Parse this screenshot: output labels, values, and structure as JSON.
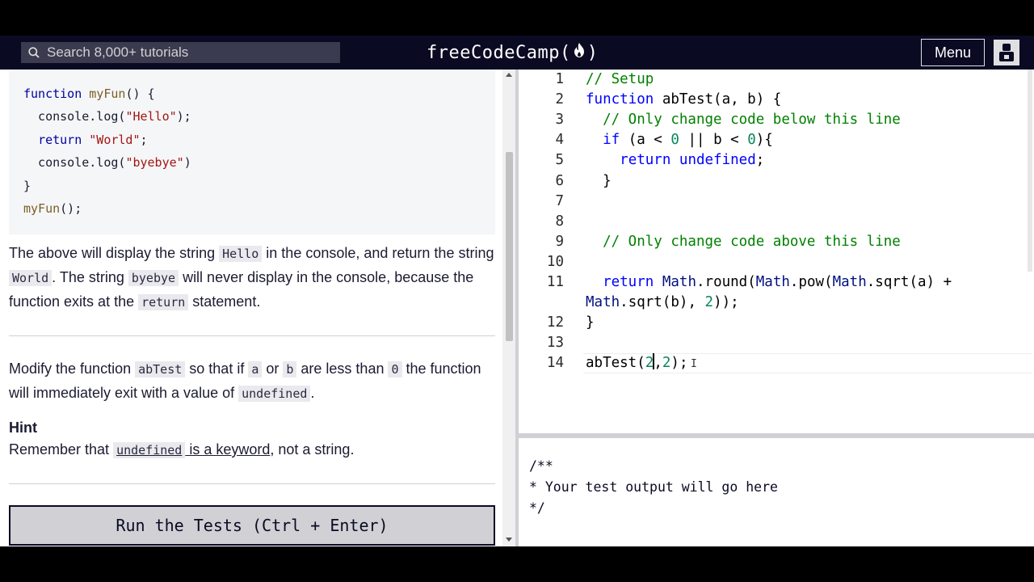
{
  "navbar": {
    "search_placeholder": "Search 8,000+ tutorials",
    "brand_left": "freeCodeCamp(",
    "brand_right": ")",
    "menu_label": "Menu",
    "bg_color": "#0a0a23"
  },
  "lesson": {
    "example_code": [
      [
        {
          "t": "kw",
          "v": "function "
        },
        {
          "t": "fn",
          "v": "myFun"
        },
        {
          "t": "plain",
          "v": "() {"
        }
      ],
      [
        {
          "t": "plain",
          "v": "  console.log("
        },
        {
          "t": "str",
          "v": "\"Hello\""
        },
        {
          "t": "plain",
          "v": ");"
        }
      ],
      [
        {
          "t": "plain",
          "v": "  "
        },
        {
          "t": "kw",
          "v": "return "
        },
        {
          "t": "str",
          "v": "\"World\""
        },
        {
          "t": "plain",
          "v": ";"
        }
      ],
      [
        {
          "t": "plain",
          "v": "  console.log("
        },
        {
          "t": "str",
          "v": "\"byebye\""
        },
        {
          "t": "plain",
          "v": ")"
        }
      ],
      [
        {
          "t": "plain",
          "v": "}"
        }
      ],
      [
        {
          "t": "fn",
          "v": "myFun"
        },
        {
          "t": "plain",
          "v": "();"
        }
      ]
    ],
    "para1": [
      {
        "text": "The above will display the string "
      },
      {
        "code": "Hello"
      },
      {
        "text": " in the console, and return the string "
      },
      {
        "code": "World"
      },
      {
        "text": ". The string "
      },
      {
        "code": "byebye"
      },
      {
        "text": " will never display in the console, because the function exits at the "
      },
      {
        "code": "return"
      },
      {
        "text": " statement."
      }
    ],
    "para2": [
      {
        "text": "Modify the function "
      },
      {
        "code": "abTest"
      },
      {
        "text": " so that if "
      },
      {
        "code": "a"
      },
      {
        "text": " or "
      },
      {
        "code": "b"
      },
      {
        "text": " are less than "
      },
      {
        "code": "0"
      },
      {
        "text": " the function will immediately exit with a value of "
      },
      {
        "code": "undefined"
      },
      {
        "text": "."
      }
    ],
    "hint_title": "Hint",
    "hint_text_before": "Remember that ",
    "hint_link_code": "undefined",
    "hint_link_text": " is a keyword",
    "hint_text_after": ", not a string.",
    "run_button_label": "Run the Tests (Ctrl + Enter)"
  },
  "editor": {
    "lines": [
      {
        "n": "1",
        "tokens": [
          {
            "t": "cm",
            "v": "// Setup"
          }
        ]
      },
      {
        "n": "2",
        "tokens": [
          {
            "t": "kw",
            "v": "function "
          },
          {
            "t": "plain",
            "v": "abTest(a, b) {"
          }
        ]
      },
      {
        "n": "3",
        "tokens": [
          {
            "t": "cm",
            "v": "  // Only change code below this line"
          }
        ]
      },
      {
        "n": "4",
        "tokens": [
          {
            "t": "plain",
            "v": "  "
          },
          {
            "t": "kw",
            "v": "if"
          },
          {
            "t": "plain",
            "v": " (a < "
          },
          {
            "t": "num",
            "v": "0"
          },
          {
            "t": "plain",
            "v": " || b < "
          },
          {
            "t": "num",
            "v": "0"
          },
          {
            "t": "plain",
            "v": "){"
          }
        ]
      },
      {
        "n": "5",
        "tokens": [
          {
            "t": "plain",
            "v": "    "
          },
          {
            "t": "kw",
            "v": "return"
          },
          {
            "t": "plain",
            "v": " "
          },
          {
            "t": "kw",
            "v": "undefined"
          },
          {
            "t": "plain",
            "v": ";"
          }
        ]
      },
      {
        "n": "6",
        "tokens": [
          {
            "t": "plain",
            "v": "  }"
          }
        ]
      },
      {
        "n": "7",
        "tokens": []
      },
      {
        "n": "8",
        "tokens": []
      },
      {
        "n": "9",
        "tokens": [
          {
            "t": "cm",
            "v": "  // Only change code above this line"
          }
        ]
      },
      {
        "n": "10",
        "tokens": []
      },
      {
        "n": "11",
        "tokens": [
          {
            "t": "plain",
            "v": "  "
          },
          {
            "t": "kw",
            "v": "return"
          },
          {
            "t": "plain",
            "v": " "
          },
          {
            "t": "id",
            "v": "Math"
          },
          {
            "t": "plain",
            "v": ".round("
          },
          {
            "t": "id",
            "v": "Math"
          },
          {
            "t": "plain",
            "v": ".pow("
          },
          {
            "t": "id",
            "v": "Math"
          },
          {
            "t": "plain",
            "v": ".sqrt(a) +"
          }
        ]
      },
      {
        "n": "",
        "tokens": [
          {
            "t": "id",
            "v": "Math"
          },
          {
            "t": "plain",
            "v": ".sqrt(b), "
          },
          {
            "t": "num",
            "v": "2"
          },
          {
            "t": "plain",
            "v": "));"
          }
        ]
      },
      {
        "n": "12",
        "tokens": [
          {
            "t": "plain",
            "v": "}"
          }
        ]
      },
      {
        "n": "13",
        "tokens": []
      },
      {
        "n": "14",
        "tokens": [
          {
            "t": "plain",
            "v": "abTest("
          },
          {
            "t": "num",
            "v": "2"
          },
          {
            "t": "caret",
            "v": ""
          },
          {
            "t": "plain",
            "v": ","
          },
          {
            "t": "num",
            "v": "2"
          },
          {
            "t": "plain",
            "v": ");"
          }
        ]
      }
    ]
  },
  "output": {
    "text": "/**\n* Your test output will go here\n*/"
  }
}
